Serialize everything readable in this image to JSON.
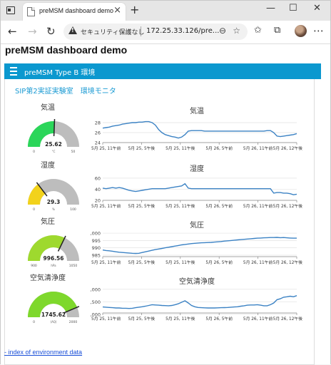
{
  "browser": {
    "tab_title": "preMSM dashboard demo",
    "security_label": "セキュリティ保護なし",
    "url": "172.25.33.126/pre..."
  },
  "page": {
    "title": "preMSM dashboard demo",
    "panel_title": "preMSM Type B 環境",
    "group_label": "SIP第2実証実験室　環境モニタ",
    "footer_link": "- index of environment data"
  },
  "gauges": [
    {
      "title": "気温",
      "value": 25.62,
      "display": "25.62",
      "unit": "°C",
      "min": "0",
      "max": "50",
      "min_v": 0,
      "max_v": 50,
      "color": "#2bd65a"
    },
    {
      "title": "湿度",
      "value": 29.3,
      "display": "29.3",
      "unit": "%",
      "min": "0",
      "max": "100",
      "min_v": 0,
      "max_v": 100,
      "color": "#f2d21b"
    },
    {
      "title": "気圧",
      "value": 996.56,
      "display": "996.56",
      "unit": "hPa",
      "min": "900",
      "max": "1050",
      "min_v": 900,
      "max_v": 1050,
      "color": "#9ed92e"
    },
    {
      "title": "空気清浄度",
      "value": 1745.62,
      "display": "1745.62",
      "unit": "(AQ)",
      "min": "0",
      "max": "2000",
      "min_v": 0,
      "max_v": 2000,
      "color": "#7ed82c"
    }
  ],
  "x_ticks": [
    "5月 25, 11午前",
    "5月 25, 5午後",
    "5月 25, 11午後",
    "5月 26, 5午前",
    "5月 26, 11午前",
    "5月 26, 12午後"
  ],
  "chart_data": [
    {
      "type": "line",
      "title": "気温",
      "xlabel": "",
      "ylabel": "",
      "ylim": [
        24,
        29
      ],
      "yticks": [
        "24",
        "26",
        "28"
      ],
      "ytick_values": [
        24,
        26,
        28
      ],
      "values": [
        26.9,
        27.0,
        27.1,
        27.3,
        27.4,
        27.5,
        27.7,
        27.8,
        27.9,
        28.0,
        28.0,
        28.1,
        28.1,
        28.2,
        28.2,
        28.0,
        27.5,
        26.6,
        26.0,
        25.6,
        25.4,
        25.2,
        25.1,
        24.9,
        25.1,
        25.6,
        26.3,
        26.4,
        26.4,
        26.4,
        26.4,
        26.3,
        26.3,
        26.3,
        26.3,
        26.3,
        26.3,
        26.3,
        26.3,
        26.3,
        26.3,
        26.3,
        26.3,
        26.3,
        26.3,
        26.3,
        26.3,
        26.3,
        26.3,
        26.3,
        26.4,
        26.4,
        26.0,
        25.3,
        25.2,
        25.3,
        25.4,
        25.5,
        25.6,
        25.8
      ],
      "color": "#3b82c4"
    },
    {
      "type": "line",
      "title": "湿度",
      "xlabel": "",
      "ylabel": "",
      "ylim": [
        20,
        65
      ],
      "yticks": [
        "20",
        "40",
        "60"
      ],
      "ytick_values": [
        20,
        40,
        60
      ],
      "values": [
        42,
        41,
        42,
        43,
        42,
        43,
        42,
        40,
        38,
        37,
        36,
        37,
        38,
        39,
        40,
        41,
        41,
        41,
        41,
        41,
        42,
        43,
        44,
        45,
        46,
        50,
        42,
        41,
        41,
        41,
        41,
        41,
        41,
        41,
        41,
        41,
        41,
        41,
        41,
        41,
        41,
        41,
        41,
        41,
        41,
        41,
        41,
        41,
        41,
        41,
        41,
        41,
        33,
        34,
        34,
        33,
        33,
        32,
        30,
        31
      ],
      "color": "#3b82c4"
    },
    {
      "type": "line",
      "title": "気圧",
      "xlabel": "",
      "ylabel": "",
      "ylim": [
        984,
        1001
      ],
      "yticks": [
        "985",
        "990",
        "995",
        "1,000"
      ],
      "ytick_values": [
        985,
        990,
        995,
        1000
      ],
      "values": [
        988.5,
        988.2,
        988.0,
        987.7,
        987.3,
        987.0,
        986.8,
        986.6,
        986.5,
        986.3,
        986.2,
        986.3,
        986.8,
        987.3,
        987.8,
        988.3,
        988.8,
        989.2,
        989.6,
        990.0,
        990.4,
        990.8,
        991.2,
        991.6,
        992.0,
        992.3,
        992.6,
        992.9,
        993.1,
        993.3,
        993.4,
        993.5,
        993.6,
        993.7,
        993.9,
        994.1,
        994.3,
        994.6,
        994.8,
        995.0,
        995.2,
        995.4,
        995.6,
        995.8,
        996.0,
        996.2,
        996.4,
        996.6,
        996.7,
        996.8,
        996.9,
        997.0,
        997.0,
        997.1,
        996.9,
        997.0,
        996.8,
        996.7,
        996.6,
        996.6
      ],
      "color": "#3b82c4"
    },
    {
      "type": "line",
      "title": "空気清浄度",
      "xlabel": "",
      "ylabel": "",
      "ylim": [
        1050,
        2050
      ],
      "yticks": [
        "1,000",
        "1,500",
        "2,000"
      ],
      "ytick_values": [
        1000,
        1500,
        2000
      ],
      "values": [
        1290,
        1280,
        1270,
        1260,
        1250,
        1250,
        1240,
        1240,
        1230,
        1240,
        1260,
        1280,
        1300,
        1320,
        1350,
        1380,
        1370,
        1360,
        1350,
        1345,
        1340,
        1350,
        1380,
        1420,
        1480,
        1540,
        1450,
        1350,
        1300,
        1270,
        1260,
        1255,
        1250,
        1250,
        1250,
        1255,
        1260,
        1265,
        1270,
        1280,
        1290,
        1300,
        1320,
        1340,
        1360,
        1370,
        1370,
        1380,
        1360,
        1340,
        1340,
        1380,
        1450,
        1580,
        1620,
        1680,
        1700,
        1720,
        1700,
        1745
      ],
      "color": "#3b82c4"
    }
  ]
}
